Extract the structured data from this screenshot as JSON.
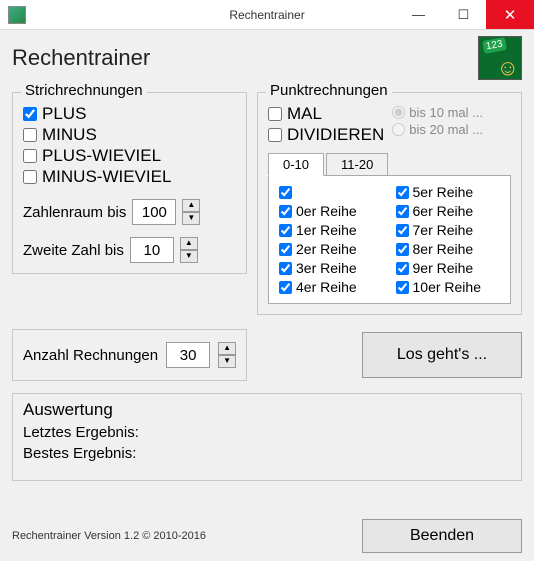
{
  "window": {
    "title": "Rechentrainer"
  },
  "header": {
    "app_title": "Rechentrainer"
  },
  "strich": {
    "title": "Strichrechnungen",
    "plus": "PLUS",
    "minus": "MINUS",
    "plus_wieviel": "PLUS-WIEVIEL",
    "minus_wieviel": "MINUS-WIEVIEL",
    "zahlenraum_label": "Zahlenraum bis",
    "zahlenraum_value": "100",
    "zweite_label": "Zweite Zahl bis",
    "zweite_value": "10"
  },
  "punkt": {
    "title": "Punktrechnungen",
    "mal": "MAL",
    "div": "DIVIDIEREN",
    "radio1": "bis 10 mal ...",
    "radio2": "bis 20 mal ...",
    "tab1": "0-10",
    "tab2": "11-20",
    "reihen_left": [
      "",
      "0er Reihe",
      "1er Reihe",
      "2er Reihe",
      "3er Reihe",
      "4er Reihe"
    ],
    "reihen_right": [
      "5er Reihe",
      "6er Reihe",
      "7er Reihe",
      "8er Reihe",
      "9er Reihe",
      "10er Reihe"
    ]
  },
  "mid": {
    "anzahl_label": "Anzahl Rechnungen",
    "anzahl_value": "30",
    "go": "Los geht's ..."
  },
  "eval": {
    "title": "Auswertung",
    "last": "Letztes Ergebnis:",
    "best": "Bestes Ergebnis:"
  },
  "footer": {
    "version": "Rechentrainer Version 1.2 © 2010-2016",
    "end": "Beenden"
  }
}
